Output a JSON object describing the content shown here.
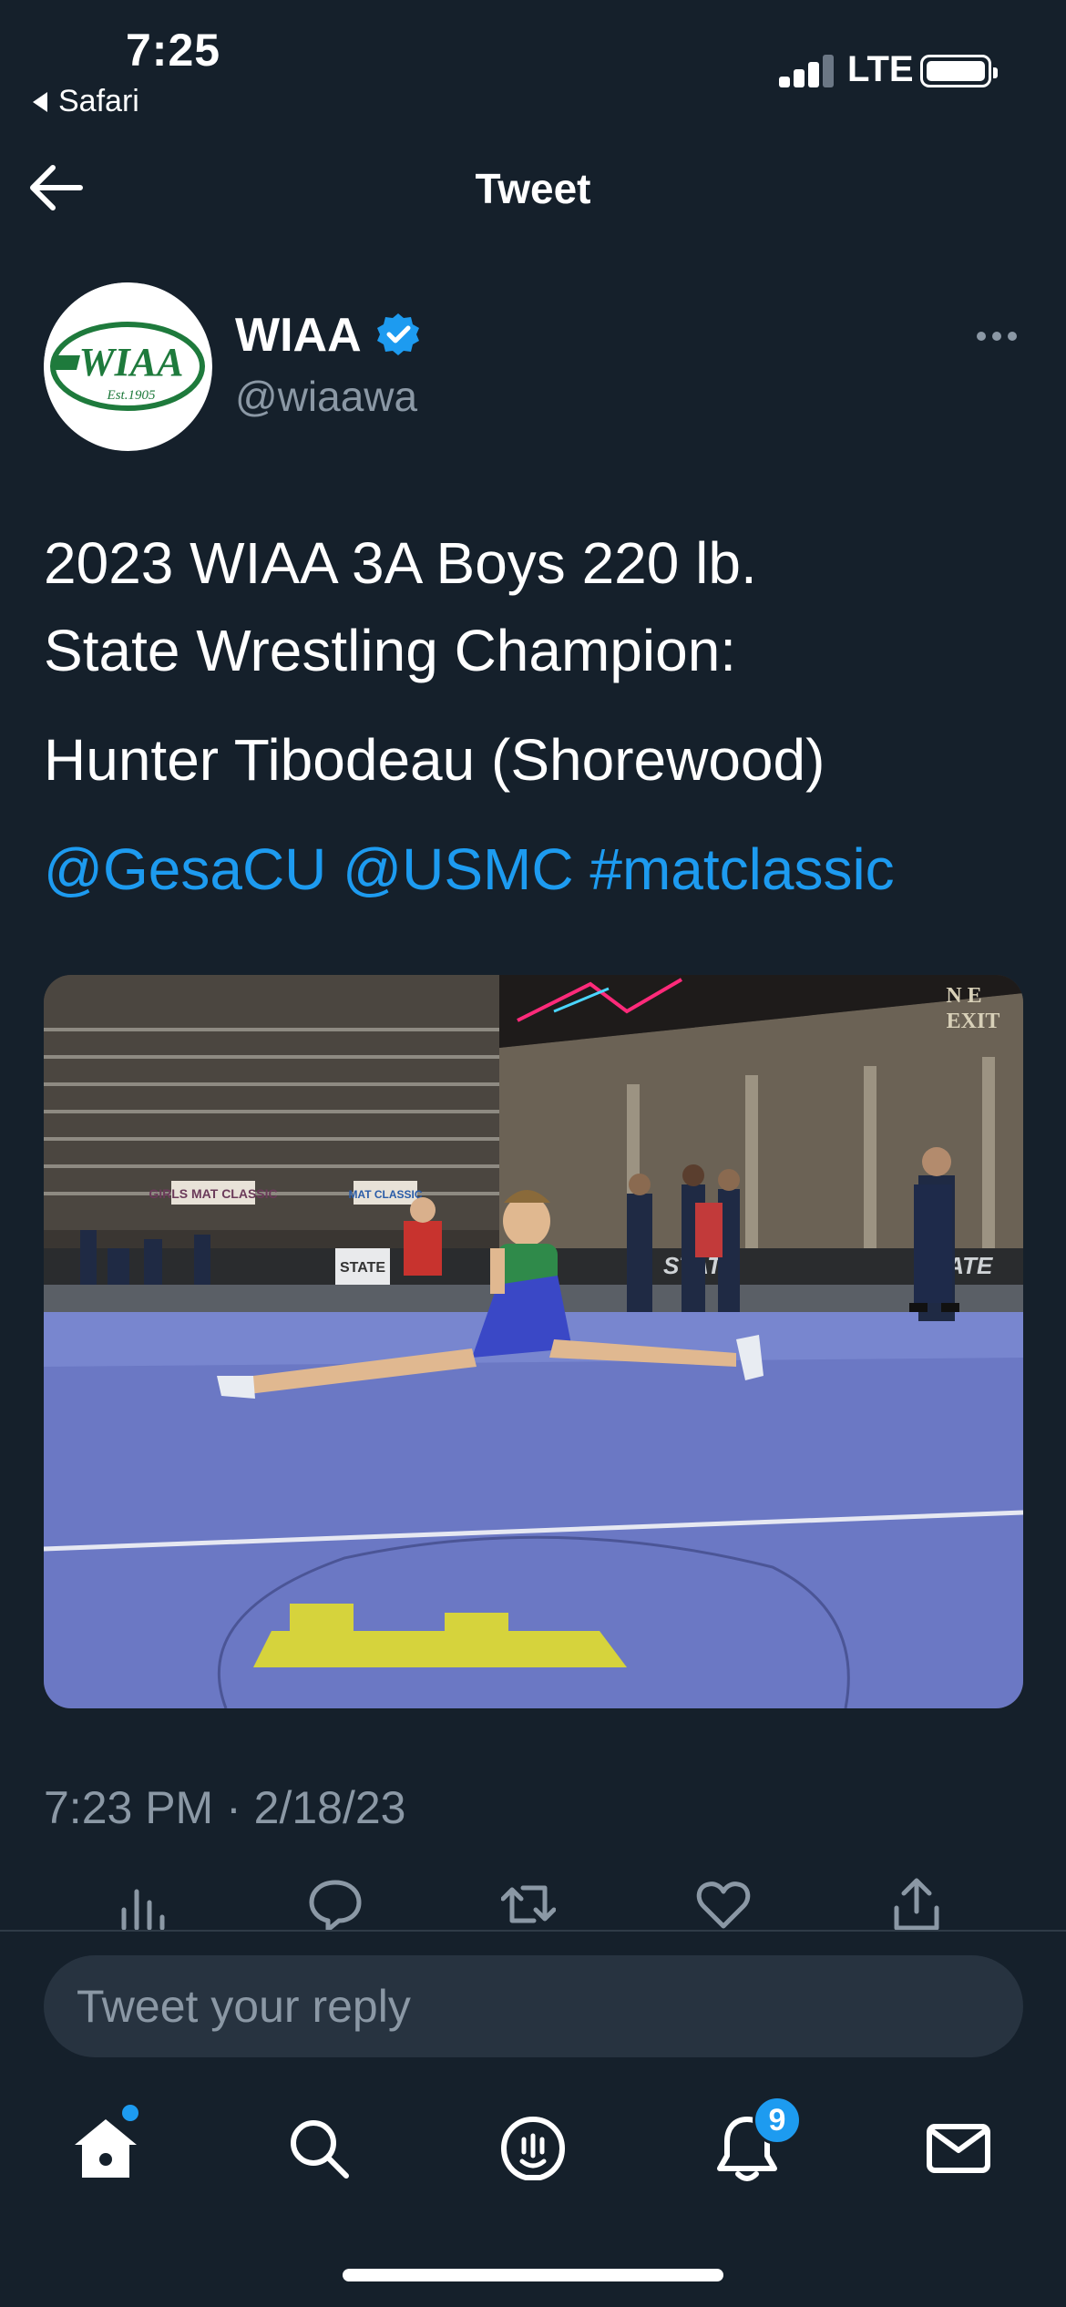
{
  "status_bar": {
    "time": "7:25",
    "back_app": "Safari",
    "network": "LTE"
  },
  "header": {
    "title": "Tweet"
  },
  "tweet": {
    "author_name": "WIAA",
    "author_handle": "@wiaawa",
    "avatar_text": "WIAA",
    "avatar_subtext": "Est.1905",
    "text_line_1": "2023 WIAA 3A Boys 220 lb.",
    "text_line_2": "State Wrestling Champion:",
    "text_line_3": "Hunter Tibodeau (Shorewood)",
    "mention_1": "@GesaCU",
    "mention_2": "@USMC",
    "hashtag": "#matclassic",
    "timestamp": "7:23 PM · 2/18/23",
    "photo": {
      "description_icon": "wrestling-photo",
      "signage": [
        "GIRLS MAT CLASSIC",
        "MAT CLASSIC",
        "STATE",
        "STATE",
        "N E EXIT"
      ]
    }
  },
  "reply": {
    "placeholder": "Tweet your reply"
  },
  "tab_bar": {
    "notification_count": "9"
  },
  "colors": {
    "background": "#15202b",
    "accent": "#1d9bf0",
    "secondary_text": "#8b98a5",
    "input_bg": "#273340"
  }
}
